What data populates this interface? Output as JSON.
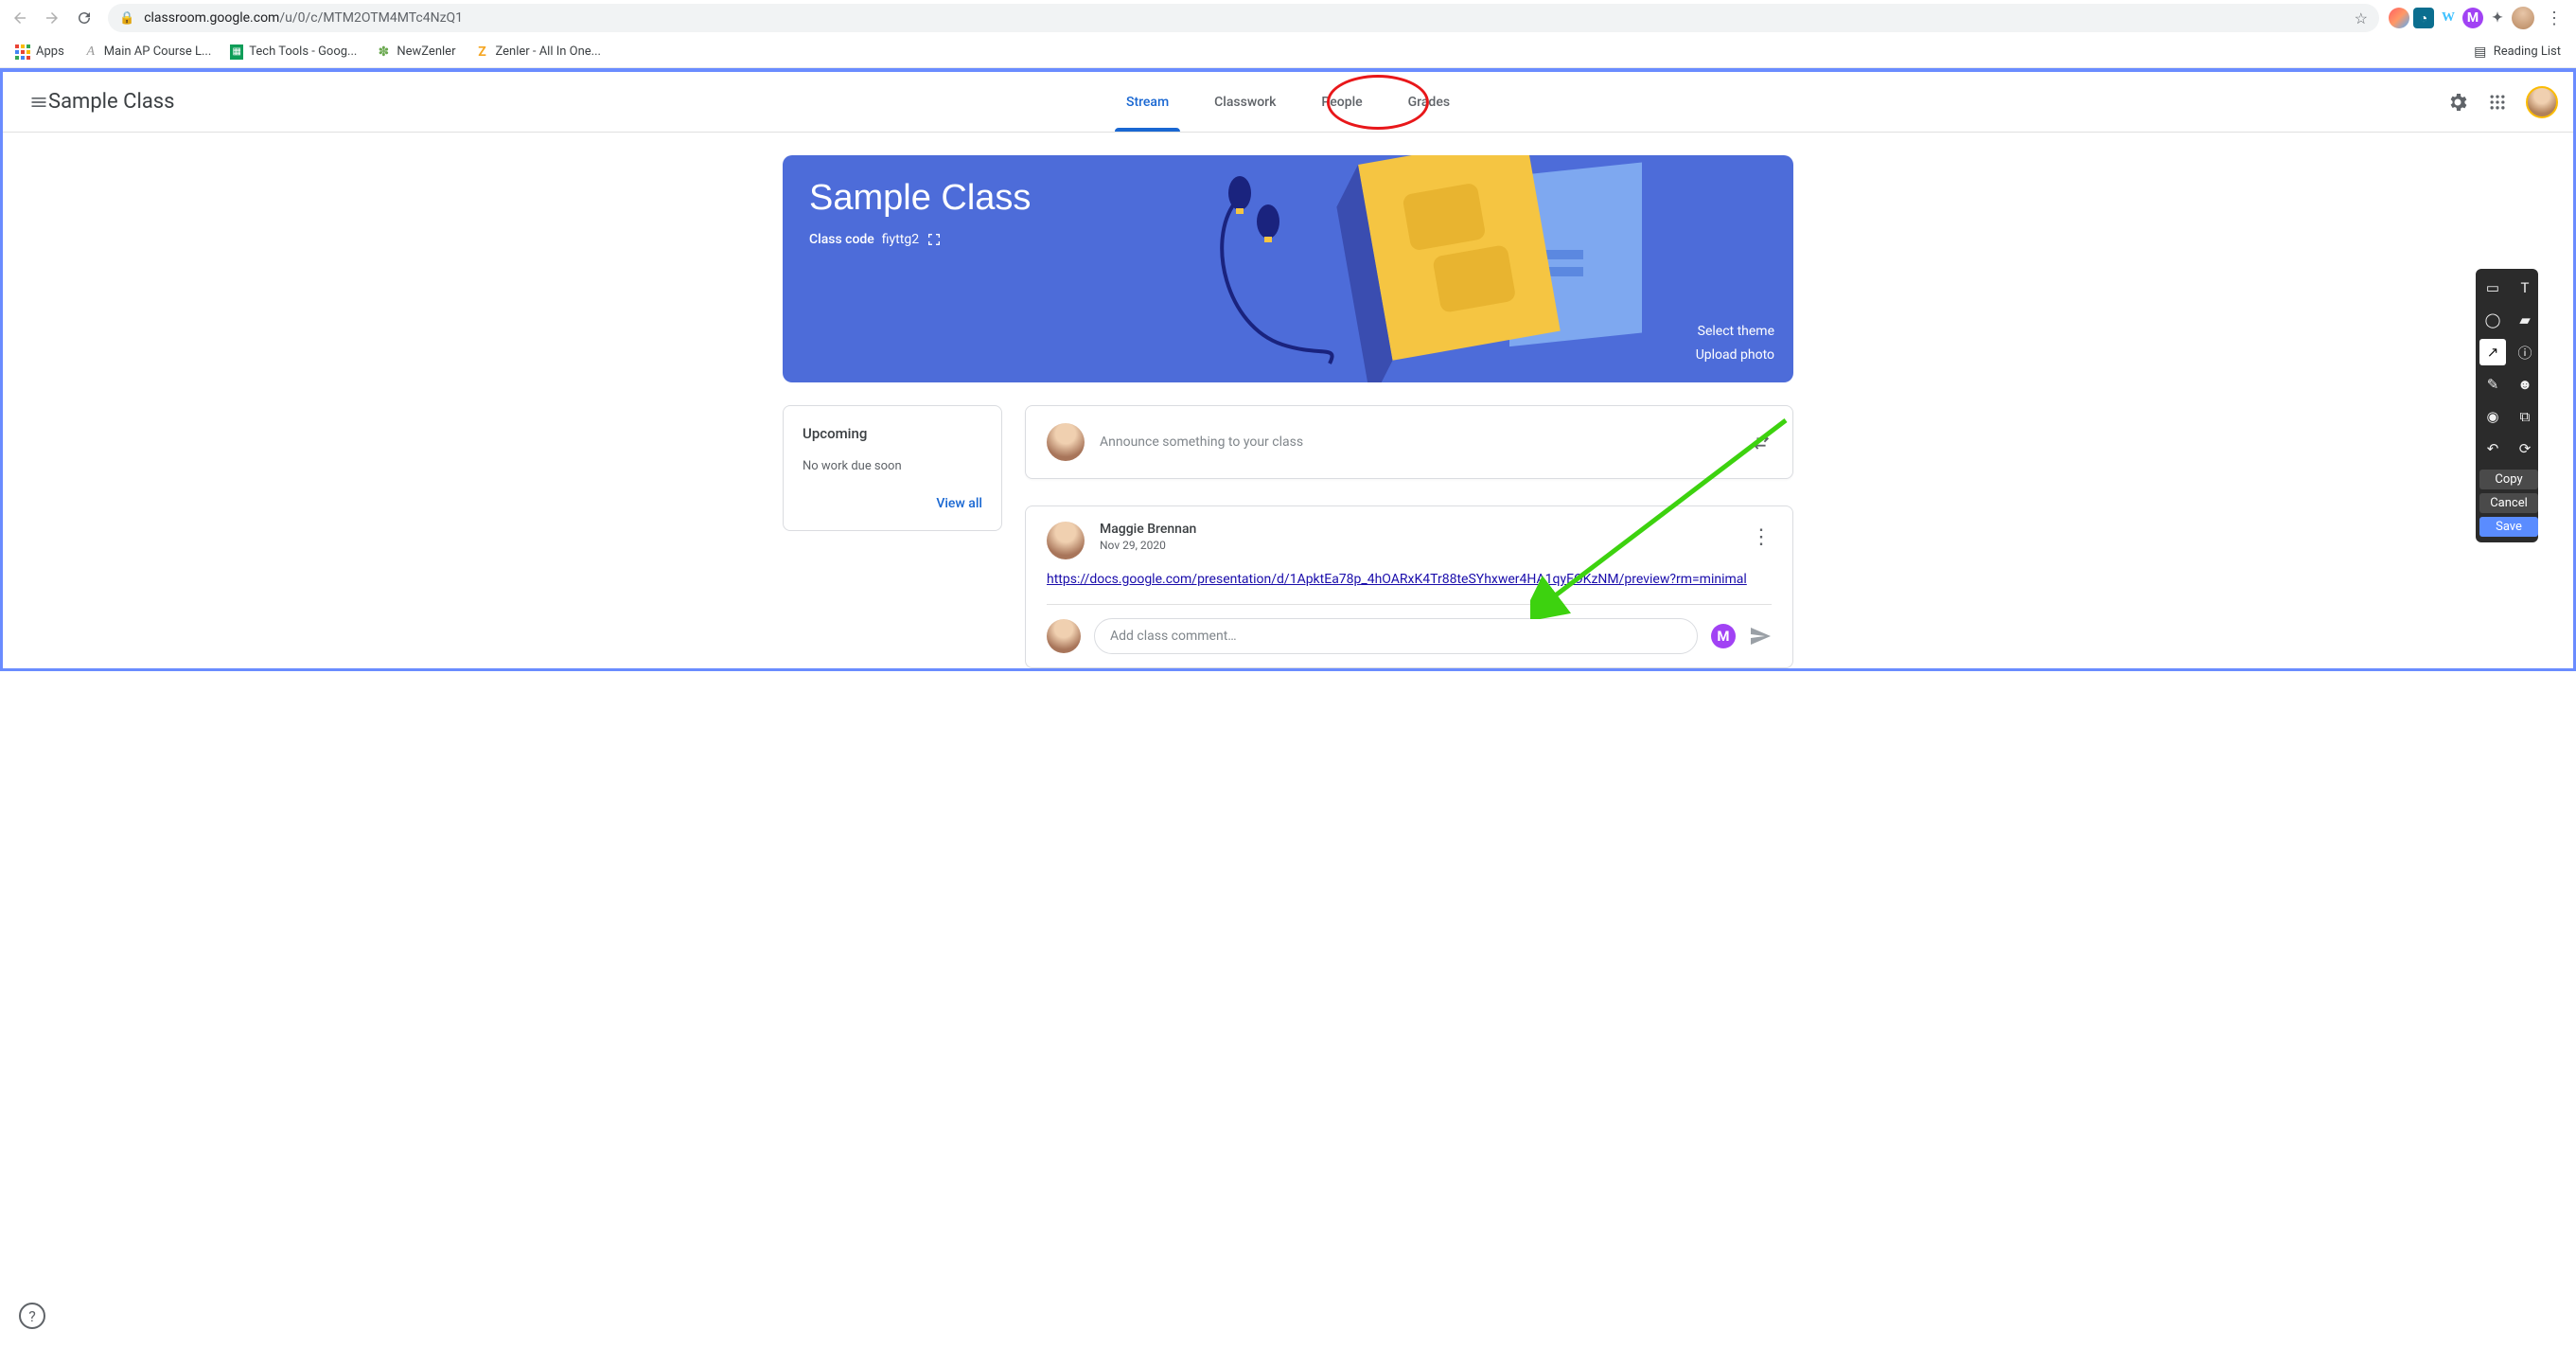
{
  "browser": {
    "url_host": "classroom.google.com",
    "url_path": "/u/0/c/MTM2OTM4MTc4NzQ1",
    "bookmarks": {
      "apps": "Apps",
      "b1": "Main AP Course L...",
      "b2": "Tech Tools - Goog...",
      "b3": "NewZenler",
      "b4": "Zenler - All In One...",
      "reading": "Reading List"
    },
    "ext_w": "W"
  },
  "header": {
    "class_name": "Sample Class",
    "tabs": {
      "stream": "Stream",
      "classwork": "Classwork",
      "people": "People",
      "grades": "Grades"
    }
  },
  "banner": {
    "title": "Sample Class",
    "code_label": "Class code",
    "code_value": "fiyttg2",
    "select_theme": "Select theme",
    "upload_photo": "Upload photo"
  },
  "upcoming": {
    "heading": "Upcoming",
    "empty": "No work due soon",
    "view_all": "View all"
  },
  "announce": {
    "placeholder": "Announce something to your class"
  },
  "post": {
    "author": "Maggie Brennan",
    "date": "Nov 29, 2020",
    "link": "https://docs.google.com/presentation/d/1ApktEa78p_4hOARxK4Tr88teSYhxwer4HA1qyEOKzNM/preview?rm=minimal",
    "comment_placeholder": "Add class comment…",
    "m_label": "M"
  },
  "toolbox": {
    "copy": "Copy",
    "cancel": "Cancel",
    "save": "Save"
  }
}
